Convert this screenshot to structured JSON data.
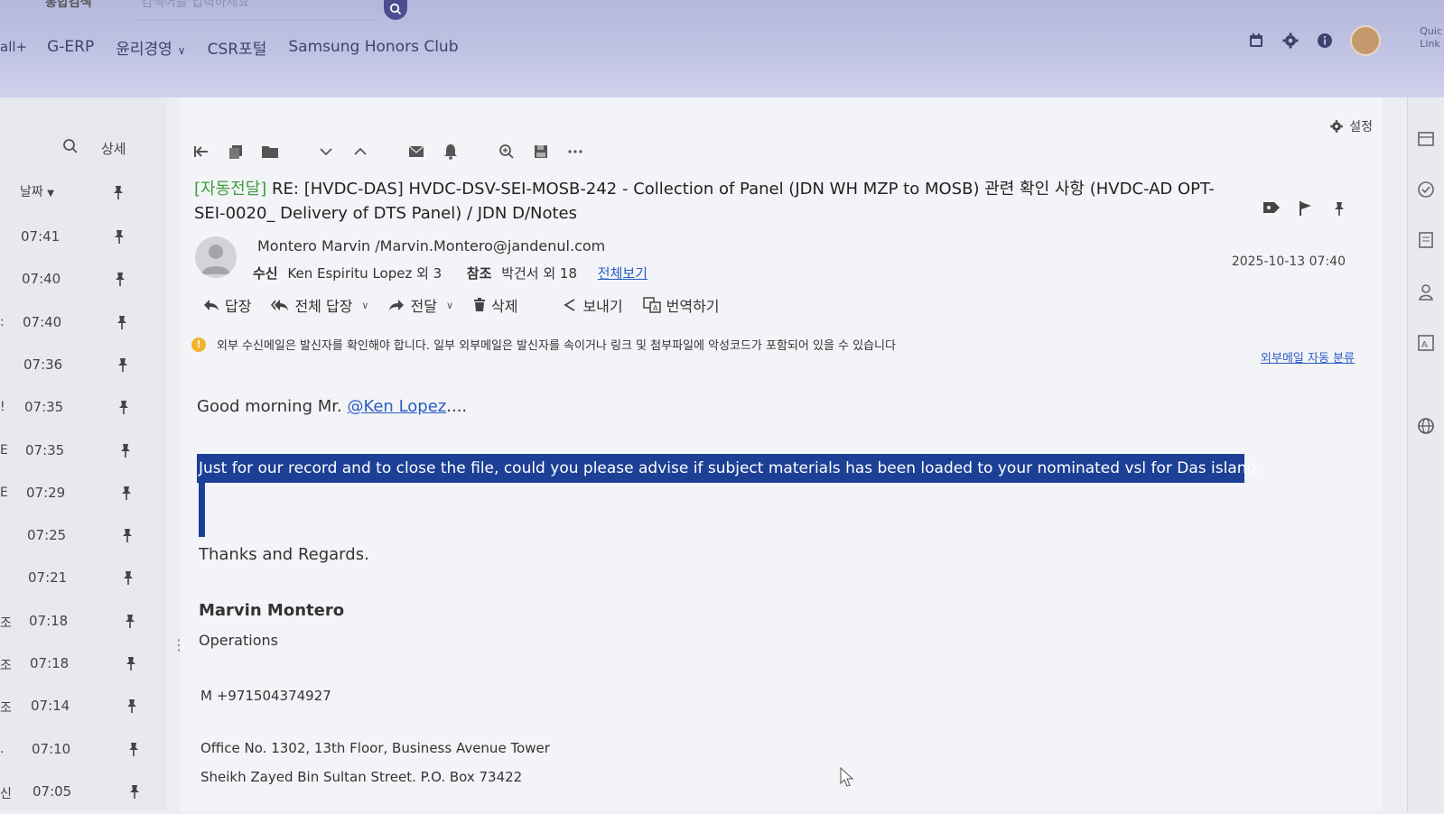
{
  "header": {
    "search_placeholder": "검색어를 입력하세요",
    "cut_label": "통합검색",
    "nav_all": "all+",
    "nav_items": [
      "G-ERP",
      "윤리경영",
      "CSR포털",
      "Samsung Honors Club"
    ],
    "quick_link_line1": "Quic",
    "quick_link_line2": "Link"
  },
  "list": {
    "detail_label": "상세",
    "sort_label": "날짜",
    "rows": [
      {
        "pre": "",
        "time": "07:41"
      },
      {
        "pre": "",
        "time": "07:40"
      },
      {
        "pre": ":",
        "time": "07:40"
      },
      {
        "pre": "",
        "time": "07:36"
      },
      {
        "pre": "!",
        "time": "07:35"
      },
      {
        "pre": "E",
        "time": "07:35"
      },
      {
        "pre": "E",
        "time": "07:29"
      },
      {
        "pre": "",
        "time": "07:25"
      },
      {
        "pre": "",
        "time": "07:21"
      },
      {
        "pre": "조",
        "time": "07:18"
      },
      {
        "pre": "조",
        "time": "07:18"
      },
      {
        "pre": "조",
        "time": "07:14"
      },
      {
        "pre": ".",
        "time": "07:10"
      },
      {
        "pre": "신",
        "time": "07:05"
      }
    ]
  },
  "mail": {
    "settings_label": "설정",
    "auto_forward_tag": "[자동전달]",
    "subject": "RE: [HVDC-DAS] HVDC-DSV-SEI-MOSB-242 - Collection of Panel (JDN WH MZP to MOSB) 관련 확인 사항 (HVDC-AD OPT-SEI-0020_ Delivery of DTS Panel) / JDN D/Notes",
    "sender": "Montero Marvin  /Marvin.Montero@jandenul.com",
    "to_label": "수신",
    "to_value": "Ken Espiritu Lopez 외 3",
    "cc_label": "참조",
    "cc_value": "박건서 외 18",
    "view_all": "전체보기",
    "datetime": "2025-10-13 07:40",
    "actions": {
      "reply": "답장",
      "reply_all": "전체 답장",
      "forward": "전달",
      "delete": "삭제",
      "send": "보내기",
      "translate": "번역하기"
    },
    "warning": "외부 수신메일은 발신자를 확인해야 합니다. 일부 외부메일은 발신자를 속이거나 링크 및 첨부파일에 악성코드가 포함되어 있을 수 있습니다",
    "external_link": "외부메일 자동 분류"
  },
  "body": {
    "greeting_prefix": "Good morning Mr. ",
    "mention": "@Ken Lopez",
    "greeting_suffix": "....",
    "highlighted": "Just for our record and to close the file, could you please advise if subject materials has been loaded to your nominated vsl for Das island.",
    "thanks": "Thanks and Regards.",
    "sig_name": "Marvin Montero",
    "sig_role": "Operations",
    "sig_mobile": "M  +971504374927",
    "sig_office": "Office No. 1302, 13th Floor, Business Avenue Tower",
    "sig_street": "Sheikh Zayed Bin Sultan Street. P.O. Box 73422"
  },
  "colors": {
    "header_bg": "#c2c4e4",
    "highlight_bg": "#1d3f95",
    "auto_tag": "#3d9c3b",
    "link": "#2a5bc4",
    "warning": "#f0b429"
  }
}
